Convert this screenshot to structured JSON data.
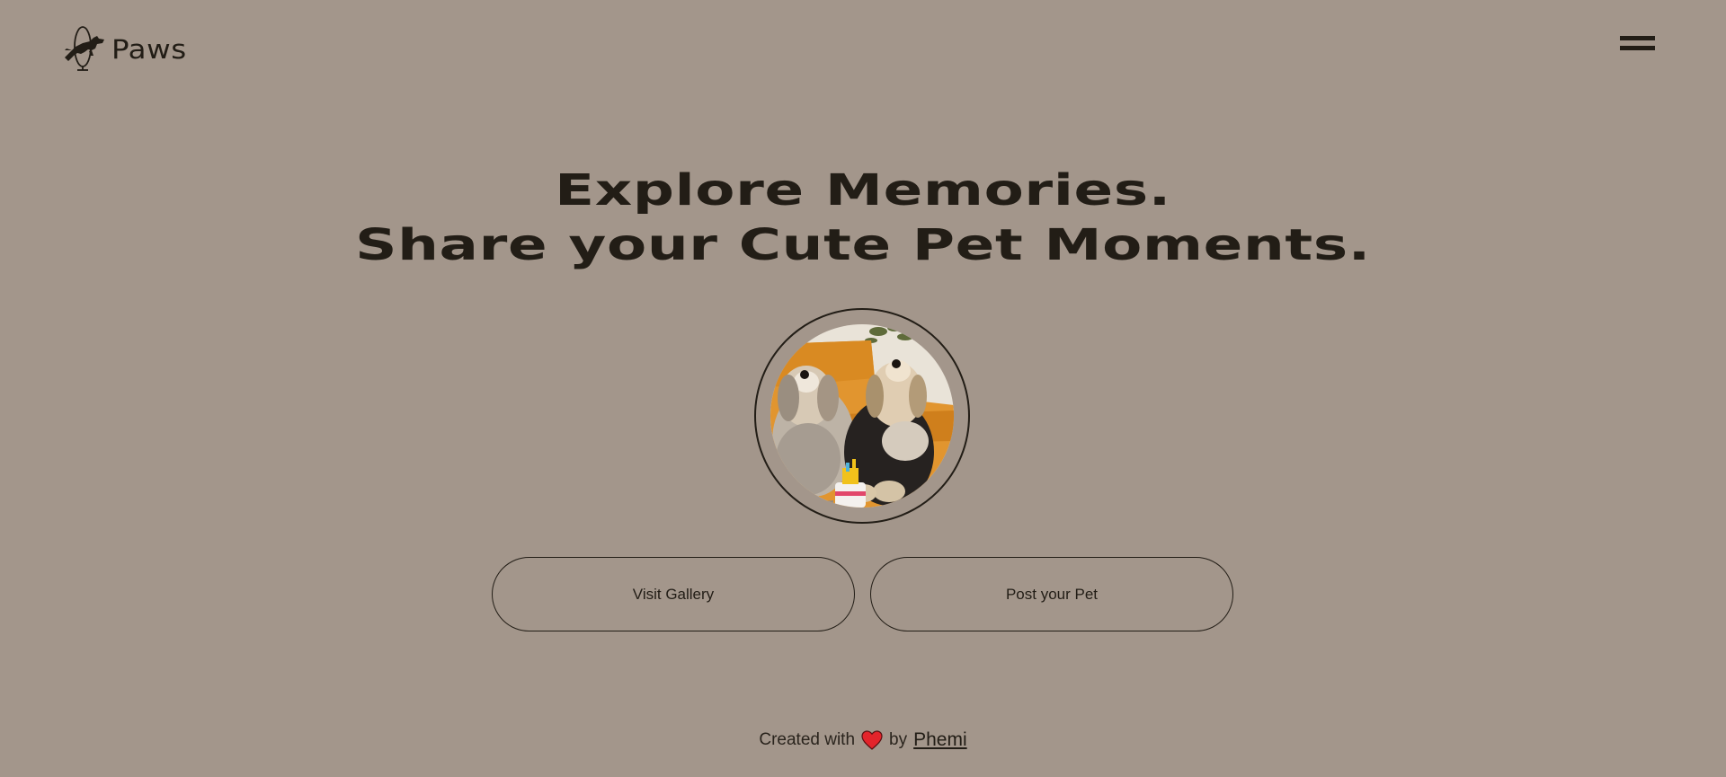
{
  "header": {
    "logo_text": "Paws",
    "logo_icon": "jumping-dog-hoop-icon",
    "menu_icon": "hamburger-menu-icon"
  },
  "hero": {
    "title_line1": "Explore Memories.",
    "title_line2": "Share your Cute Pet Moments.",
    "image_alt": "two small dogs sitting on an orange couch"
  },
  "actions": {
    "gallery_label": "Visit Gallery",
    "post_label": "Post your Pet"
  },
  "footer": {
    "created_with": "Created with",
    "heart_icon": "heart-icon",
    "by_text": "by",
    "author_link": "Phemi"
  },
  "colors": {
    "background": "#a3968b",
    "text": "#221d16",
    "heart": "#e3242b"
  }
}
